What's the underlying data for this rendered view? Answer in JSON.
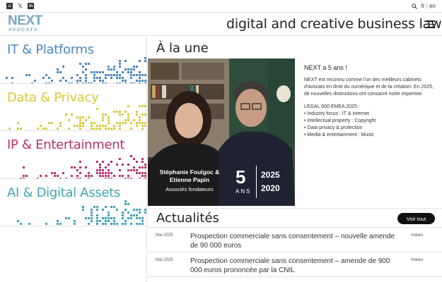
{
  "topbar": {
    "social": [
      {
        "icon": "instagram-icon",
        "glyph": "◘"
      },
      {
        "icon": "x-icon",
        "glyph": "𝕏"
      },
      {
        "icon": "linkedin-icon",
        "glyph": "in"
      }
    ],
    "lang_fr": "fr",
    "lang_sep": "|",
    "lang_en": "en"
  },
  "header": {
    "logo_main": "NEXT",
    "logo_sub": "AVOCATS",
    "tagline": "digital and creative business law"
  },
  "sections": [
    {
      "label": "IT & Platforms",
      "color": "#4a87c0"
    },
    {
      "label": "Data & Privacy",
      "color": "#d8c93a"
    },
    {
      "label": "IP & Entertainment",
      "color": "#b8316e"
    },
    {
      "label": "AI & Digital Assets",
      "color": "#3fa3b5"
    }
  ],
  "une": {
    "heading": "À la une",
    "photo_caption_names": [
      "Stéphanie Foulgoc &",
      "Etienne Papin"
    ],
    "photo_caption_role": "Associés fondateurs",
    "badge_number": "5",
    "badge_word": "ANS",
    "badge_year_top": "2025",
    "badge_year_bottom": "2020",
    "title": "NEXT a 5 ans !",
    "paragraph": "NEXT est reconnu comme l'un des meilleurs cabinets d'avocats en droit du numérique et de la création. En 2025, de nouvelles distinctions ont consacré notre expertise.",
    "legal_title": "LEGAL 500 EMEA 2025 :",
    "legal_items": [
      "• Industry focus : IT & internet",
      "• Intellectual property : Copyright",
      "• Data privacy & protection",
      "• Media & entertainment : Music"
    ]
  },
  "actu": {
    "heading": "Actualités",
    "voir_tout": "Voir tout",
    "items": [
      {
        "date": "Mai 2025",
        "title": "Prospection commerciale sans consentement – nouvelle amende de 90 000 euros",
        "tag": "#news"
      },
      {
        "date": "Mai 2025",
        "title": "Prospection commerciale sans consentement – amende de 900 000 euros prononcée par la CNIL",
        "tag": "#news"
      }
    ]
  }
}
